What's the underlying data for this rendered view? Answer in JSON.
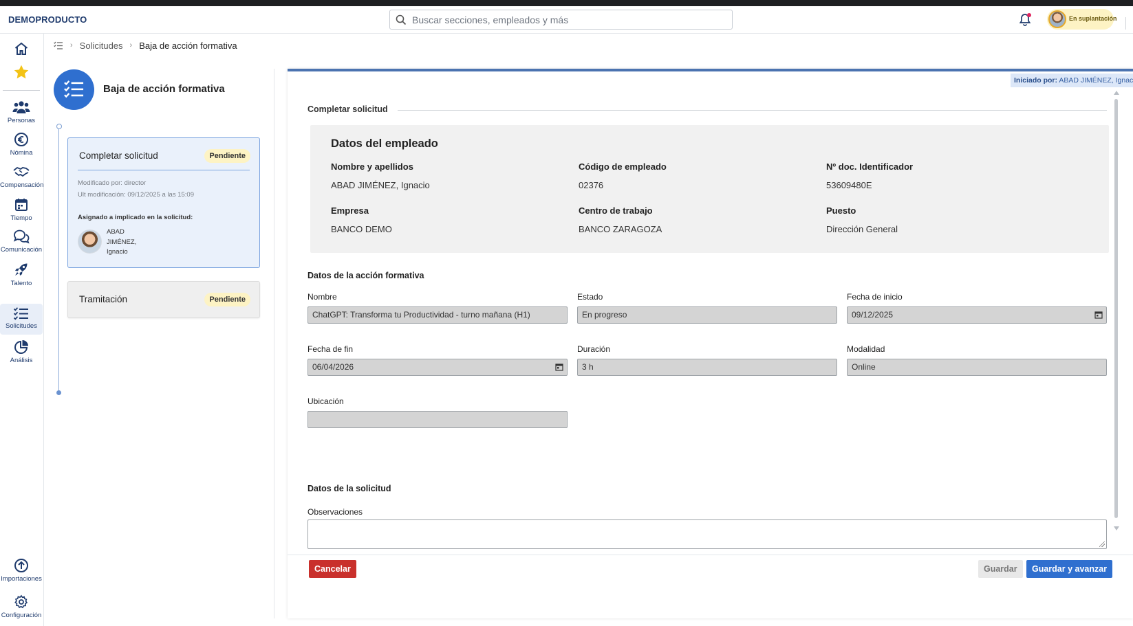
{
  "app": {
    "brand": "DEMOPRODUCTO"
  },
  "search": {
    "placeholder": "Buscar secciones, empleados y más"
  },
  "user": {
    "impersonation_label": "En suplantación"
  },
  "sidenav": {
    "items": [
      {
        "icon": "home-icon",
        "label": ""
      },
      {
        "icon": "star-icon",
        "label": ""
      },
      {
        "icon": "people-icon",
        "label": "Personas"
      },
      {
        "icon": "euro-icon",
        "label": "Nómina"
      },
      {
        "icon": "handshake-icon",
        "label": "Compensación"
      },
      {
        "icon": "calendar-icon",
        "label": "Tiempo"
      },
      {
        "icon": "chat-icon",
        "label": "Comunicación"
      },
      {
        "icon": "rocket-icon",
        "label": "Talento"
      },
      {
        "icon": "checklist-icon",
        "label": "Solicitudes"
      },
      {
        "icon": "pie-chart-icon",
        "label": "Análisis"
      },
      {
        "icon": "upload-icon",
        "label": "Importaciones"
      },
      {
        "icon": "gear-icon",
        "label": "Configuración"
      }
    ]
  },
  "breadcrumb": {
    "parent": "Solicitudes",
    "current": "Baja de acción formativa"
  },
  "panel": {
    "title": "Baja de acción formativa",
    "steps": [
      {
        "title": "Completar solicitud",
        "status": "Pendiente",
        "modified_by": "Modificado por: director",
        "last_modified": "Ult modificación: 09/12/2025 a las 15:09",
        "assigned_label": "Asignado a implicado en la solicitud:",
        "assignee_lines": [
          "ABAD",
          "JIMÉNEZ,",
          "Ignacio"
        ]
      },
      {
        "title": "Tramitación",
        "status": "Pendiente"
      }
    ]
  },
  "main": {
    "initiated_label": "Iniciado por:",
    "initiated_value": "ABAD JIMÉNEZ, Ignacio",
    "section_title": "Completar solicitud",
    "employee": {
      "title": "Datos del empleado",
      "fields": [
        {
          "label": "Nombre y apellidos",
          "value": "ABAD JIMÉNEZ, Ignacio"
        },
        {
          "label": "Código de empleado",
          "value": "02376"
        },
        {
          "label": "Nº doc. Identificador",
          "value": "53609480E"
        },
        {
          "label": "Empresa",
          "value": "BANCO DEMO"
        },
        {
          "label": "Centro de trabajo",
          "value": "BANCO ZARAGOZA"
        },
        {
          "label": "Puesto",
          "value": "Dirección General"
        }
      ]
    },
    "training": {
      "title": "Datos de la acción formativa",
      "fields": [
        {
          "label": "Nombre",
          "value": "ChatGPT: Transforma tu Productividad - turno mañana (H1)"
        },
        {
          "label": "Estado",
          "value": "En progreso"
        },
        {
          "label": "Fecha de inicio",
          "value": "09/12/2025"
        },
        {
          "label": "Fecha de fin",
          "value": "06/04/2026"
        },
        {
          "label": "Duración",
          "value": "3 h"
        },
        {
          "label": "Modalidad",
          "value": "Online"
        },
        {
          "label": "Ubicación",
          "value": ""
        }
      ]
    },
    "request": {
      "title": "Datos de la solicitud",
      "observations_label": "Observaciones",
      "observations_value": ""
    },
    "buttons": {
      "cancel": "Cancelar",
      "save": "Guardar",
      "save_next": "Guardar y avanzar"
    }
  },
  "colors": {
    "accent": "#2f6fcf",
    "danger": "#c9302c",
    "badge": "#fdf3c4",
    "nav_text": "#1f3b6d"
  }
}
